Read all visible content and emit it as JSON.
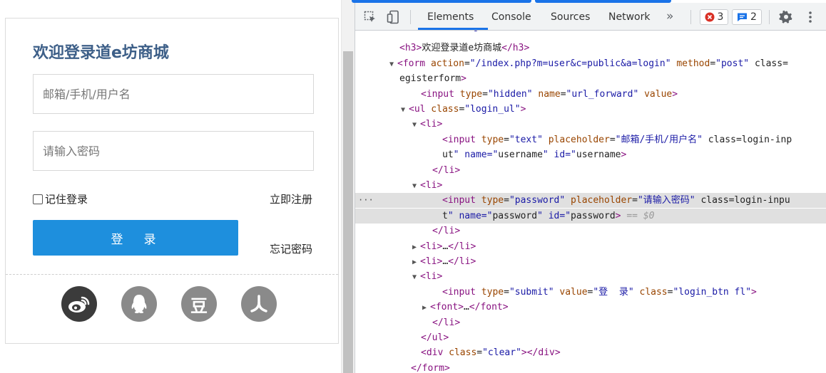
{
  "login": {
    "title": "欢迎登录道e坊商城",
    "username_placeholder": "邮箱/手机/用户名",
    "password_placeholder": "请输入密码",
    "remember_label": "记住登录",
    "register_link": "立即注册",
    "login_button": "登　录",
    "forgot_link": "忘记密码",
    "social_icons": [
      "weibo-icon",
      "qq-icon",
      "douban-icon",
      "renren-icon"
    ],
    "douban_glyph": "豆",
    "accent_color": "#1e8fdd",
    "title_color": "#3d5f88"
  },
  "devtools": {
    "tabs": [
      "Elements",
      "Console",
      "Sources",
      "Network"
    ],
    "more_tabs": "»",
    "active_tab": "Elements",
    "error_count": "3",
    "message_count": "2",
    "lines": [
      {
        "indent": 48,
        "tri": "",
        "html": "top_partial"
      },
      {
        "indent": 62,
        "tri": "",
        "code": "<h3>欢迎登录道e坊商城</h3>"
      },
      {
        "indent": 62,
        "tri": "▼",
        "code": "<form action=\"/index.php?m=user&c=public&a=login\" method=\"post\" class=\""
      },
      {
        "indent": 62,
        "tri": "",
        "code": "egisterform\">"
      },
      {
        "indent": 92,
        "tri": "",
        "code": "<input type=\"hidden\" name=\"url_forward\" value>"
      },
      {
        "indent": 78,
        "tri": "▼",
        "code": "<ul class=\"login_ul\">"
      },
      {
        "indent": 94,
        "tri": "▼",
        "code": "<li>"
      },
      {
        "indent": 122,
        "tri": "",
        "code": "<input type=\"text\" placeholder=\"邮箱/手机/用户名\" class=\"login-inp"
      },
      {
        "indent": 122,
        "tri": "",
        "code": "ut\" name=\"username\" id=\"username\">"
      },
      {
        "indent": 108,
        "tri": "",
        "code": "</li>"
      },
      {
        "indent": 94,
        "tri": "▼",
        "code": "<li>"
      },
      {
        "indent": 122,
        "tri": "",
        "code": "<input type=\"password\" placeholder=\"请输入密码\" class=\"login-inpu"
      },
      {
        "indent": 122,
        "tri": "",
        "code": "t\" name=\"password\" id=\"password\"> == $0"
      },
      {
        "indent": 108,
        "tri": "",
        "code": "</li>"
      },
      {
        "indent": 94,
        "tri": "▶",
        "code": "<li>…</li>"
      },
      {
        "indent": 94,
        "tri": "▶",
        "code": "<li>…</li>"
      },
      {
        "indent": 94,
        "tri": "▼",
        "code": "<li>"
      },
      {
        "indent": 122,
        "tri": "",
        "code": "<input type=\"submit\" value=\"登  录\" class=\"login_btn fl\">"
      },
      {
        "indent": 108,
        "tri": "▶",
        "code": "<font>…</font>"
      },
      {
        "indent": 108,
        "tri": "",
        "code": "</li>"
      },
      {
        "indent": 92,
        "tri": "",
        "code": "</ul>"
      },
      {
        "indent": 92,
        "tri": "",
        "code": "<div class=\"clear\"></div>"
      },
      {
        "indent": 78,
        "tri": "",
        "code": "</form>"
      }
    ],
    "selected_line": 11,
    "ellipsis_marker": "···"
  }
}
